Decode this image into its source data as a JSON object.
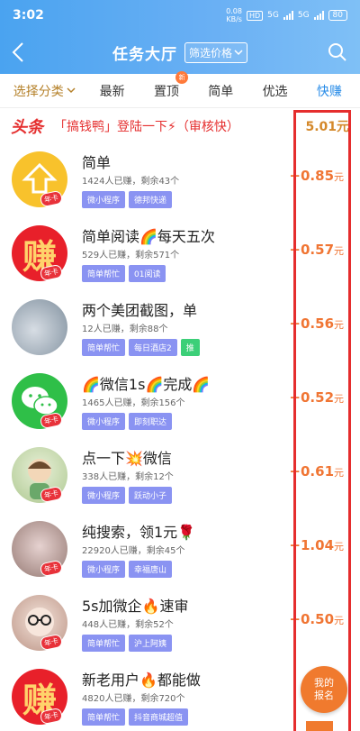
{
  "status_bar": {
    "time": "3:02",
    "speed_value": "0.08",
    "speed_unit": "KB/s",
    "hd": "HD",
    "net1": "5G",
    "net2": "5G",
    "battery": "80"
  },
  "header": {
    "title": "任务大厅",
    "filter_label": "筛选价格"
  },
  "tabs": [
    {
      "label": "选择分类"
    },
    {
      "label": "最新"
    },
    {
      "label": "置顶",
      "badge": "新"
    },
    {
      "label": "简单"
    },
    {
      "label": "优选"
    },
    {
      "label": "快赚"
    }
  ],
  "headline": {
    "logo": "头条",
    "text": "「搞钱鸭」登陆一下⚡（审核快）",
    "amount": "5.01元"
  },
  "crown_label": "年卡",
  "tasks": [
    {
      "title": "简单",
      "stats": "1424人已赚，剩余43个",
      "chips": [
        "微小程序",
        "德邦快递"
      ],
      "amount": "+0.85",
      "unit": "元",
      "avatar": "up-arrow-avatar"
    },
    {
      "title": "简单阅读🌈每天五次",
      "stats": "529人已赚，剩余571个",
      "chips": [
        "简单帮忙",
        "01阅读"
      ],
      "amount": "+0.57",
      "unit": "元",
      "avatar": "zhuan-avatar",
      "avatar_text": "赚"
    },
    {
      "title": "两个美团截图，单",
      "stats": "12人已赚，剩余88个",
      "chips": [
        "简单帮忙",
        "每日酒店2",
        "推"
      ],
      "amount": "+0.56",
      "unit": "元",
      "avatar": "photo-avatar"
    },
    {
      "title": "🌈微信1s🌈完成🌈",
      "stats": "1465人已赚，剩余156个",
      "chips": [
        "微小程序",
        "即刻职达"
      ],
      "amount": "+0.52",
      "unit": "元",
      "avatar": "wechat-avatar"
    },
    {
      "title": "点一下💥微信",
      "stats": "338人已赚，剩余12个",
      "chips": [
        "微小程序",
        "跃动小子"
      ],
      "amount": "+0.61",
      "unit": "元",
      "avatar": "cartoon-avatar"
    },
    {
      "title": "纯搜索，领1元🌹",
      "stats": "22920人已赚，剩余45个",
      "chips": [
        "微小程序",
        "幸福唐山"
      ],
      "amount": "+1.04",
      "unit": "元",
      "avatar": "photo-avatar"
    },
    {
      "title": "5s加微企🔥速审",
      "stats": "448人已赚，剩余52个",
      "chips": [
        "简单帮忙",
        "沪上阿姨"
      ],
      "amount": "+0.50",
      "unit": "元",
      "avatar": "photo-avatar"
    },
    {
      "title": "新老用户🔥都能做",
      "stats": "4820人已赚，剩余720个",
      "chips": [
        "简单帮忙",
        "抖音商城超值"
      ],
      "amount": "",
      "unit": "",
      "avatar": "zhuan-avatar",
      "avatar_text": "赚"
    }
  ],
  "float_button": {
    "line1": "我的",
    "line2": "报名"
  }
}
